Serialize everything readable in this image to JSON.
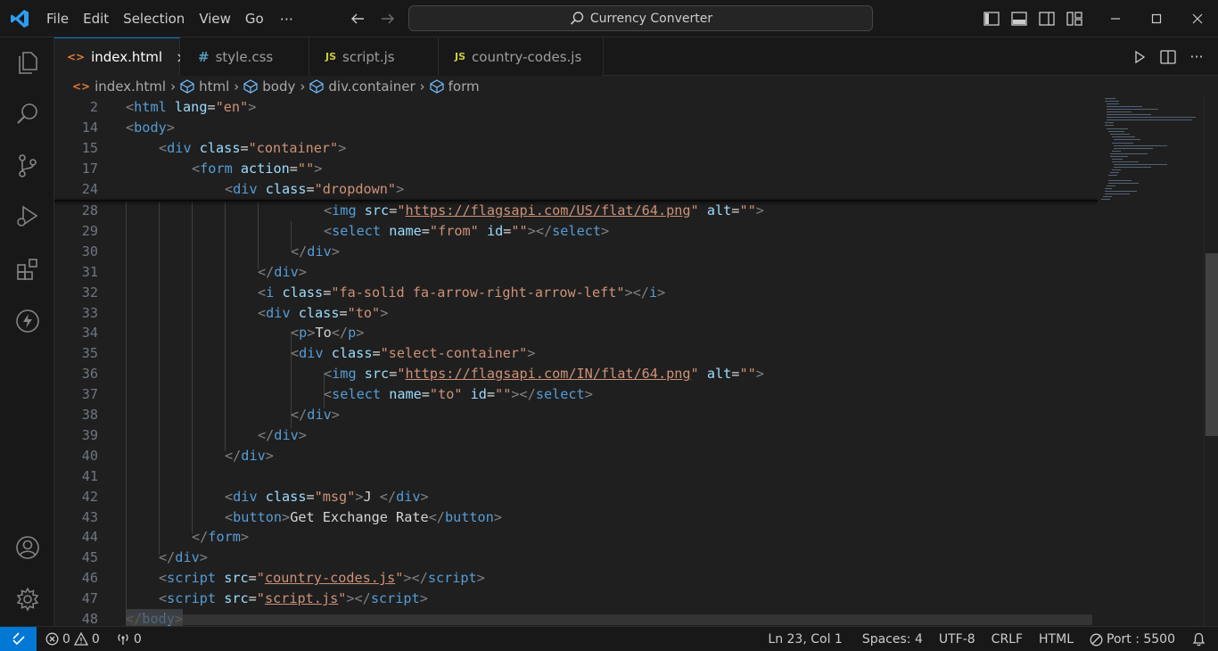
{
  "titlebar": {
    "menu": [
      "File",
      "Edit",
      "Selection",
      "View",
      "Go"
    ],
    "more": "···",
    "search_text": "Currency Converter"
  },
  "tabs": [
    {
      "icon": "<>",
      "label": "index.html",
      "close": "×"
    },
    {
      "icon": "#",
      "label": "style.css"
    },
    {
      "icon": "JS",
      "label": "script.js"
    },
    {
      "icon": "JS",
      "label": "country-codes.js"
    }
  ],
  "breadcrumb": [
    "index.html",
    "html",
    "body",
    "div.container",
    "form"
  ],
  "editor": {
    "sticky_lines": [
      {
        "n": "2"
      },
      {
        "n": "14"
      },
      {
        "n": "15"
      },
      {
        "n": "17"
      },
      {
        "n": "24"
      }
    ],
    "lines": [
      {
        "n": "28"
      },
      {
        "n": "29"
      },
      {
        "n": "30"
      },
      {
        "n": "31"
      },
      {
        "n": "32"
      },
      {
        "n": "33"
      },
      {
        "n": "34"
      },
      {
        "n": "35"
      },
      {
        "n": "36"
      },
      {
        "n": "37"
      },
      {
        "n": "38"
      },
      {
        "n": "39"
      },
      {
        "n": "40"
      },
      {
        "n": "41"
      },
      {
        "n": "42"
      },
      {
        "n": "43"
      },
      {
        "n": "44"
      },
      {
        "n": "45"
      },
      {
        "n": "46"
      },
      {
        "n": "47"
      },
      {
        "n": "48"
      }
    ],
    "code": {
      "html_tag": "html",
      "lang_attr": "lang",
      "lang_val": "\"en\"",
      "body_tag": "body",
      "div_tag": "div",
      "class_attr": "class",
      "container_val": "\"container\"",
      "form_tag": "form",
      "action_attr": "action",
      "action_val": "\"\"",
      "dropdown_val": "\"dropdown\"",
      "img_tag": "img",
      "src_attr": "src",
      "alt_attr": "alt",
      "empty_val": "\"\"",
      "us_flag_url": "https://flagsapi.com/US/flat/64.png",
      "in_flag_url": "https://flagsapi.com/IN/flat/64.png",
      "select_tag": "select",
      "name_attr": "name",
      "id_attr": "id",
      "from_val": "\"from\"",
      "to_val": "\"to\"",
      "i_tag": "i",
      "arrow_val": "\"fa-solid fa-arrow-right-arrow-left\"",
      "to_class_val": "\"to\"",
      "p_tag": "p",
      "to_text": "To",
      "select_container_val": "\"select-container\"",
      "msg_val": "\"msg\"",
      "msg_text": "J ",
      "button_tag": "button",
      "button_text": "Get Exchange Rate",
      "script_tag": "script",
      "cc_file": "country-codes.js",
      "script_file": "script.js",
      "q": "\""
    }
  },
  "statusbar": {
    "errors": "0",
    "warnings": "0",
    "ports": "0",
    "position": "Ln 23, Col 1",
    "spaces": "Spaces: 4",
    "encoding": "UTF-8",
    "eol": "CRLF",
    "language": "HTML",
    "port": "Port : 5500"
  },
  "colors": {
    "accent": "#0078d4",
    "tag": "#569cd6",
    "attribute": "#9cdcfe",
    "string": "#ce9178"
  }
}
